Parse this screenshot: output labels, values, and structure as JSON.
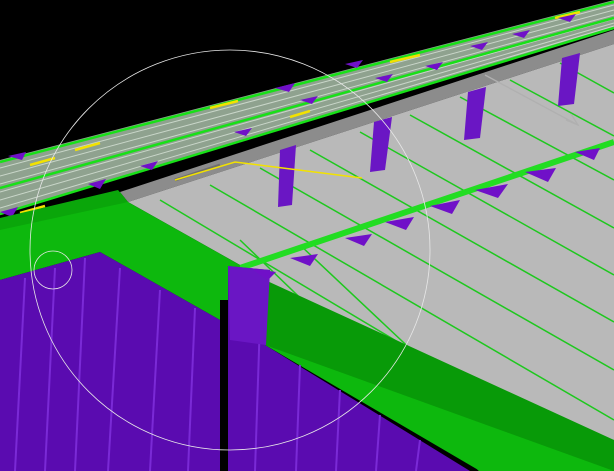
{
  "viewport": {
    "label": "",
    "background": "#000000"
  },
  "palette": {
    "wall_purple": "#5a0bb0",
    "wall_purple_light": "#7a2ad6",
    "slab_green": "#0db80d",
    "slab_green_dark": "#089a08",
    "deck_gray": "#b9b9b9",
    "deck_gray_dark": "#9a9a9a",
    "beam_green": "#22dd22",
    "line_green": "#1ec81e",
    "stripe_gray": "#8a9a8a",
    "highlight_yellow": "#f2e200",
    "post_purple": "#6a16c4",
    "arrow_purple": "#7010c8",
    "orbit_white": "#e8e8e8",
    "ridge_gray": "#8c8c8c"
  },
  "icons": [
    "orbit-ring-icon",
    "orbit-handle-icon",
    "axis-arrow-icon"
  ]
}
